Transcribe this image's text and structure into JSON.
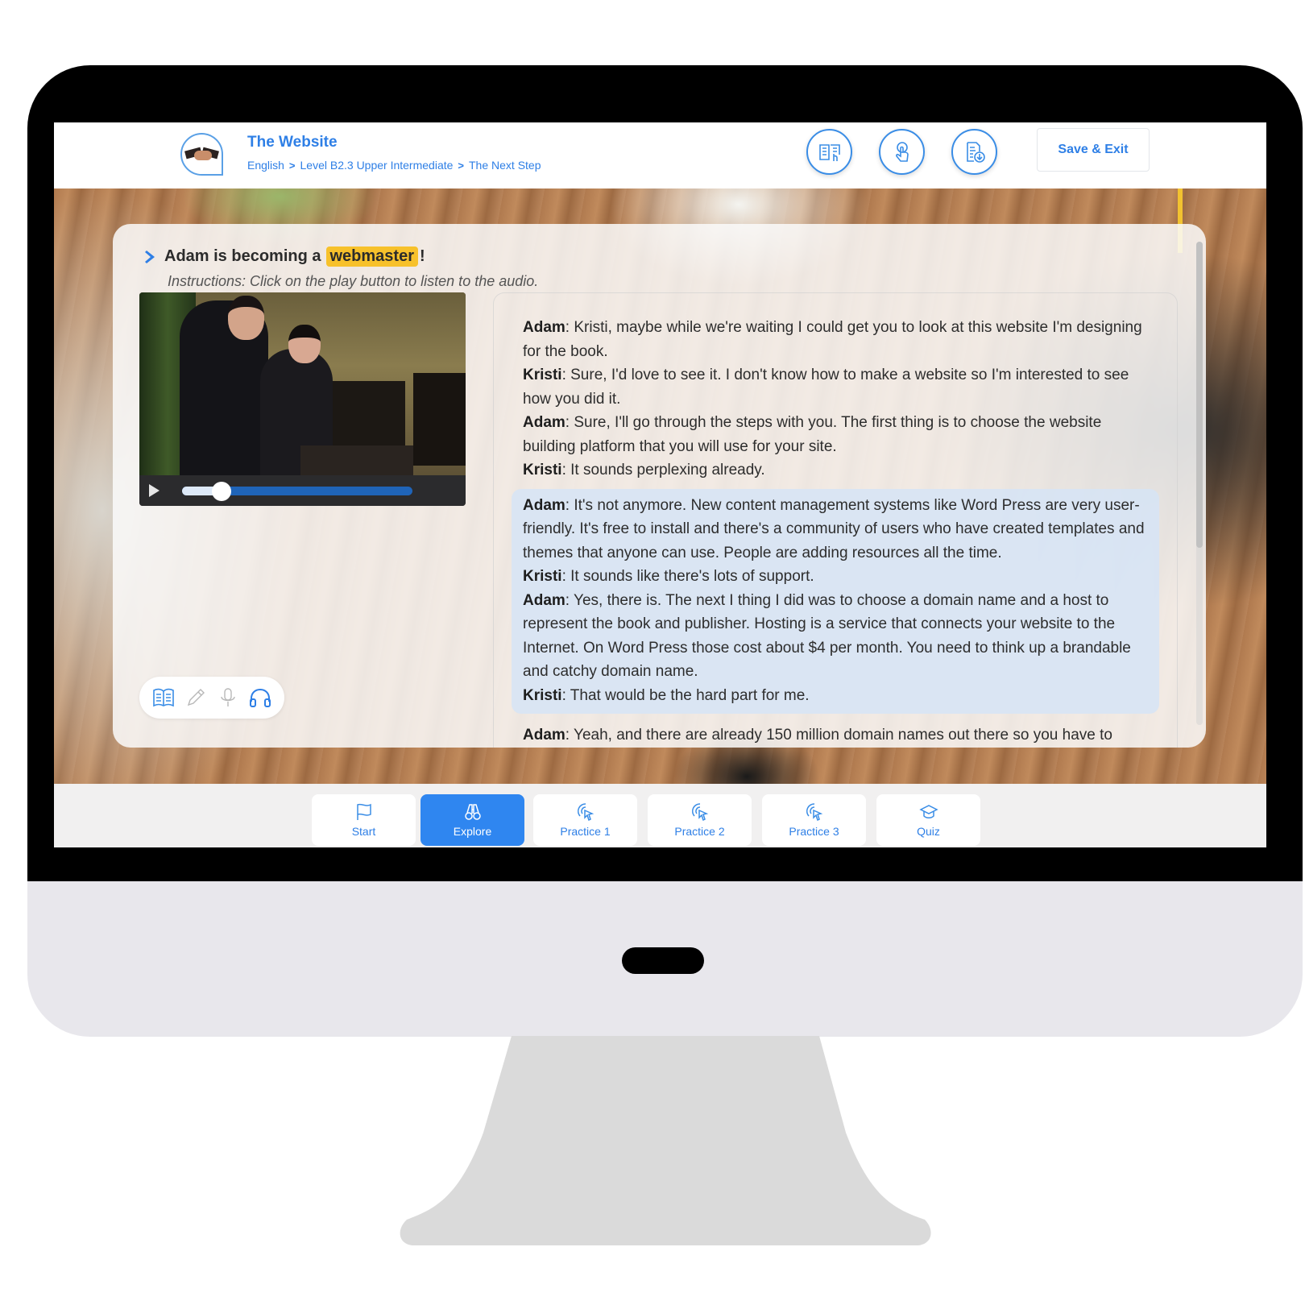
{
  "header": {
    "course_title": "The Website",
    "breadcrumb": [
      "English",
      "Level B2.3 Upper Intermediate",
      "The Next Step"
    ],
    "breadcrumb_separator": ">",
    "tools": [
      {
        "icon": "reading-book-icon"
      },
      {
        "icon": "touch-hand-icon"
      },
      {
        "icon": "document-download-icon"
      }
    ],
    "save_exit_label": "Save & Exit"
  },
  "lesson": {
    "heading_prefix": "Adam is becoming a",
    "heading_highlight": "webmaster",
    "heading_suffix": "!",
    "instructions": "Instructions: Click on the play button to listen to the audio."
  },
  "player": {
    "progress": 0.17,
    "state": "paused"
  },
  "media_tools": [
    {
      "icon": "book-icon",
      "active": true
    },
    {
      "icon": "pencil-icon",
      "active": false
    },
    {
      "icon": "microphone-icon",
      "active": false
    },
    {
      "icon": "headphones-icon",
      "active": true
    }
  ],
  "transcript": {
    "blocks": [
      {
        "active": false,
        "lines": [
          {
            "speaker": "Adam",
            "text": ": Kristi, maybe while we're waiting I could get you to look at this website I'm designing for the book."
          },
          {
            "speaker": "Kristi",
            "text": ": Sure, I'd love to see it. I don't know how to make a website so I'm interested to see how you did it."
          },
          {
            "speaker": "Adam",
            "text": ": Sure, I'll go through the steps with you. The first thing is to choose the website building platform that you will use for your site."
          },
          {
            "speaker": "Kristi",
            "text": ": It sounds perplexing already."
          }
        ]
      },
      {
        "active": true,
        "lines": [
          {
            "speaker": "Adam",
            "text": ": It's not anymore. New content management systems like Word Press are very user-friendly. It's free to install and there's a community of users who have created templates and themes that anyone can use. People are adding resources all the time."
          },
          {
            "speaker": "Kristi",
            "text": ": It sounds like there's lots of support."
          },
          {
            "speaker": "Adam",
            "text": ": Yes, there is. The next I thing I did was to choose a domain name and a host to represent the book and publisher. Hosting is a service that connects your website to the Internet. On Word Press those cost about $4 per month. You need to think up a brandable and catchy domain name."
          },
          {
            "speaker": "Kristi",
            "text": ": That would be the hard part for me."
          }
        ]
      },
      {
        "active": false,
        "lines": [
          {
            "speaker": "Adam",
            "text": ": Yeah, and there are already 150 million domain names out there so you have to"
          }
        ]
      }
    ]
  },
  "nav": {
    "items": [
      {
        "label": "Start",
        "icon": "flag-icon",
        "active": false
      },
      {
        "label": "Explore",
        "icon": "binoculars-icon",
        "active": true
      },
      {
        "label": "Practice 1",
        "icon": "pointer-click-icon",
        "active": false
      },
      {
        "label": "Practice 2",
        "icon": "pointer-click-icon",
        "active": false
      },
      {
        "label": "Practice 3",
        "icon": "pointer-click-icon",
        "active": false
      },
      {
        "label": "Quiz",
        "icon": "graduation-cap-icon",
        "active": false
      }
    ]
  },
  "colors": {
    "accent": "#2e7fe6",
    "nav_active": "#2f86f0",
    "highlight": "#f7c12b",
    "active_block": "#d6e4f6"
  }
}
